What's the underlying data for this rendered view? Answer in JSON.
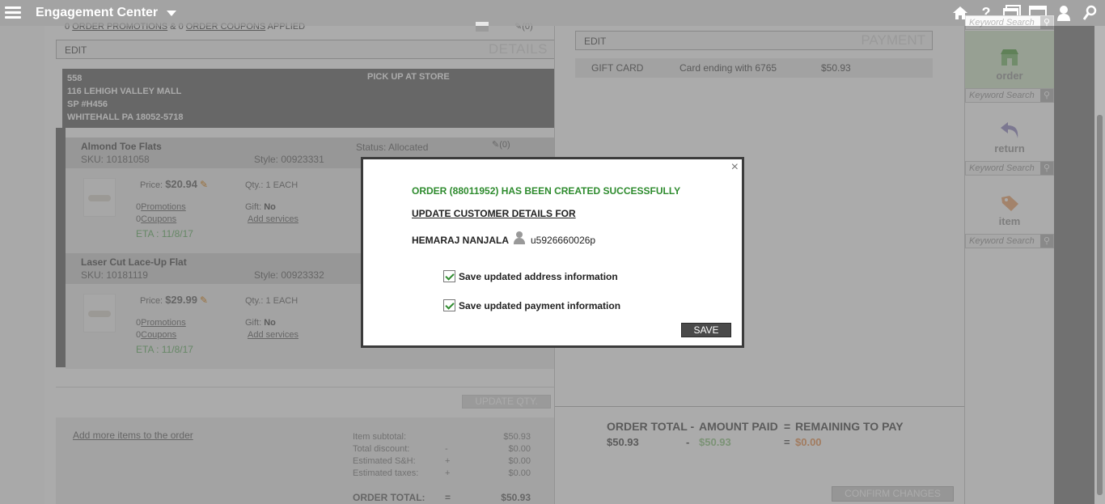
{
  "app": {
    "title": "Engagement Center"
  },
  "top_icons": [
    "home-icon",
    "help-icon",
    "windows-icon",
    "window-icon",
    "user-icon",
    "search-icon"
  ],
  "promo": {
    "count1": "0",
    "label1": "ORDER PROMOTIONS",
    "amp": "&",
    "count2": "0",
    "label2": "ORDER COUPONS",
    "suffix": "APPLIED",
    "note_count": "(0)"
  },
  "details": {
    "edit": "EDIT",
    "title": "DETAILS"
  },
  "store": {
    "line1": "558",
    "line2": "116 LEHIGH VALLEY MALL",
    "line3": "SP #H456",
    "line4": "WHITEHALL PA 18052-5718",
    "fulfillment": "PICK UP AT STORE"
  },
  "items": [
    {
      "name": "Almond Toe Flats",
      "sku": "SKU: 10181058",
      "style": "Style: 00923331",
      "status": "Status: Allocated",
      "notes": "(0)",
      "price_label": "Price:",
      "price": "$20.94",
      "qty": "Qty.:  1  EACH",
      "promotions_count": "0",
      "promotions": "Promotions",
      "coupons_count": "0",
      "coupons": "Coupons",
      "gift_label": "Gift:",
      "gift": "No",
      "add_services": "Add services",
      "eta": "ETA : 11/8/17"
    },
    {
      "name": "Laser Cut Lace-Up Flat",
      "sku": "SKU: 10181119",
      "style": "Style: 00923332",
      "price_label": "Price:",
      "price": "$29.99",
      "qty": "Qty.:  1  EACH",
      "promotions_count": "0",
      "promotions": "Promotions",
      "coupons_count": "0",
      "coupons": "Coupons",
      "gift_label": "Gift:",
      "gift": "No",
      "add_services": "Add services",
      "eta": "ETA : 11/8/17"
    }
  ],
  "update_qty": "UPDATE QTY.",
  "add_more": "Add more items to the order",
  "summary": [
    {
      "label": "Item subtotal:",
      "op": "",
      "value": "$50.93"
    },
    {
      "label": "Total discount:",
      "op": "-",
      "value": "$0.00"
    },
    {
      "label": "Estimated S&H:",
      "op": "+",
      "value": "$0.00"
    },
    {
      "label": "Estimated taxes:",
      "op": "+",
      "value": "$0.00"
    }
  ],
  "order_total": {
    "label": "ORDER TOTAL:",
    "op": "=",
    "value": "$50.93"
  },
  "payment": {
    "edit": "EDIT",
    "title": "PAYMENT",
    "type": "GIFT CARD",
    "card": "Card ending with 6765",
    "amount": "$50.93"
  },
  "totals": {
    "order_total_label": "ORDER TOTAL -",
    "amount_paid_label": "AMOUNT PAID",
    "eq": "=",
    "remaining_label": "REMAINING TO PAY",
    "order_total": "$50.93",
    "dash": "-",
    "amount_paid": "$50.93",
    "eq2": "=",
    "remaining": "$0.00",
    "colors": {
      "paid": "#b9dcb0",
      "remaining": "#f2b98f"
    }
  },
  "confirm": "CONFIRM CHANGES",
  "sidebar": {
    "search_placeholder": "Keyword Search",
    "order": "order",
    "return": "return",
    "item": "item"
  },
  "modal": {
    "success": "ORDER (88011952) HAS BEEN CREATED SUCCESSFULLY",
    "update": "UPDATE CUSTOMER DETAILS FOR",
    "name": "HEMARAJ NANJALA",
    "user_id": "u5926660026p",
    "opt_address": "Save updated address information",
    "opt_payment": "Save updated payment information",
    "save": "SAVE",
    "close": "×"
  }
}
